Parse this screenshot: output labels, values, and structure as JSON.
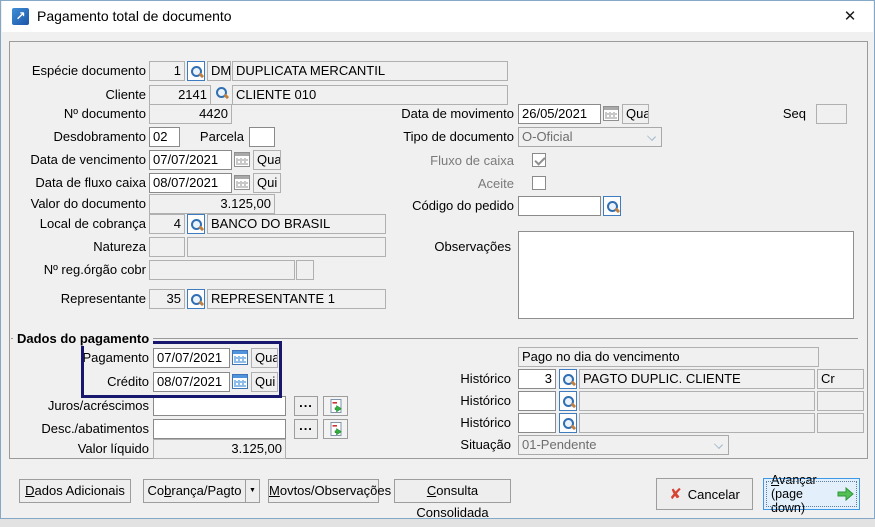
{
  "icons": {
    "close": "✕",
    "app_arrow": "↗",
    "dropdown_arrow": "▼",
    "cancel_x": "✘"
  },
  "window": {
    "title": "Pagamento total de documento"
  },
  "form": {
    "especie": {
      "label": "Espécie documento",
      "code": "1",
      "abbr": "DM",
      "desc": "DUPLICATA MERCANTIL"
    },
    "cliente": {
      "label": "Cliente",
      "code": "2141",
      "desc": "CLIENTE 010"
    },
    "num_documento": {
      "label": "Nº documento",
      "value": "4420"
    },
    "desdobramento": {
      "label": "Desdobramento",
      "value": "02"
    },
    "parcela": {
      "label": "Parcela",
      "value": ""
    },
    "data_vencimento": {
      "label": "Data de vencimento",
      "value": "07/07/2021",
      "dow": "Qua"
    },
    "data_fluxo_caixa": {
      "label": "Data de fluxo caixa",
      "value": "08/07/2021",
      "dow": "Qui"
    },
    "valor_documento": {
      "label": "Valor do documento",
      "value": "3.125,00"
    },
    "local_cobranca": {
      "label": "Local de cobrança",
      "code": "4",
      "desc": "BANCO DO BRASIL"
    },
    "natureza": {
      "label": "Natureza",
      "code": "",
      "desc": ""
    },
    "reg_orgao_cobr": {
      "label": "Nº reg.órgão cobr",
      "value": "",
      "extra": ""
    },
    "representante": {
      "label": "Representante",
      "code": "35",
      "desc": "REPRESENTANTE 1"
    },
    "data_movimento": {
      "label": "Data de movimento",
      "value": "26/05/2021",
      "dow": "Qua"
    },
    "seq": {
      "label": "Seq",
      "value": ""
    },
    "tipo_documento": {
      "label": "Tipo de documento",
      "value": "O-Oficial"
    },
    "fluxo_caixa": {
      "label": "Fluxo de caixa",
      "checked": true
    },
    "aceite": {
      "label": "Aceite",
      "checked": false
    },
    "codigo_pedido": {
      "label": "Código do pedido",
      "value": ""
    },
    "observacoes": {
      "label": "Observações",
      "value": ""
    }
  },
  "pagamento": {
    "legend": "Dados do pagamento",
    "pagamento": {
      "label": "Pagamento",
      "value": "07/07/2021",
      "dow": "Qua"
    },
    "credito": {
      "label": "Crédito",
      "value": "08/07/2021",
      "dow": "Qui"
    },
    "juros": {
      "label": "Juros/acréscimos",
      "value": "",
      "dots": "..."
    },
    "descontos": {
      "label": "Desc./abatimentos",
      "value": "",
      "dots": "..."
    },
    "valor_liquido": {
      "label": "Valor líquido",
      "value": "3.125,00"
    },
    "pago_info": "Pago no dia do vencimento",
    "historico1": {
      "label": "Histórico",
      "code": "3",
      "desc": "PAGTO DUPLIC. CLIENTE",
      "cr": "Cr"
    },
    "historico2": {
      "label": "Histórico",
      "code": "",
      "desc": "",
      "cr": ""
    },
    "historico3": {
      "label": "Histórico",
      "code": "",
      "desc": "",
      "cr": ""
    },
    "situacao": {
      "label": "Situação",
      "value": "01-Pendente"
    }
  },
  "buttons": {
    "dados_adicionais": {
      "key": "D",
      "rest": "ados Adicionais"
    },
    "cobranca_pagto": {
      "pre": "Co",
      "key": "b",
      "rest": "rança/Pagto"
    },
    "movtos": {
      "key": "M",
      "rest": "ovtos/Observações"
    },
    "consulta": {
      "key": "C",
      "rest": "onsulta Consolidada"
    },
    "cancelar": {
      "label": "Cancelar"
    },
    "avancar": {
      "key": "A",
      "rest": "vançar",
      "line2": "(page down)"
    }
  }
}
